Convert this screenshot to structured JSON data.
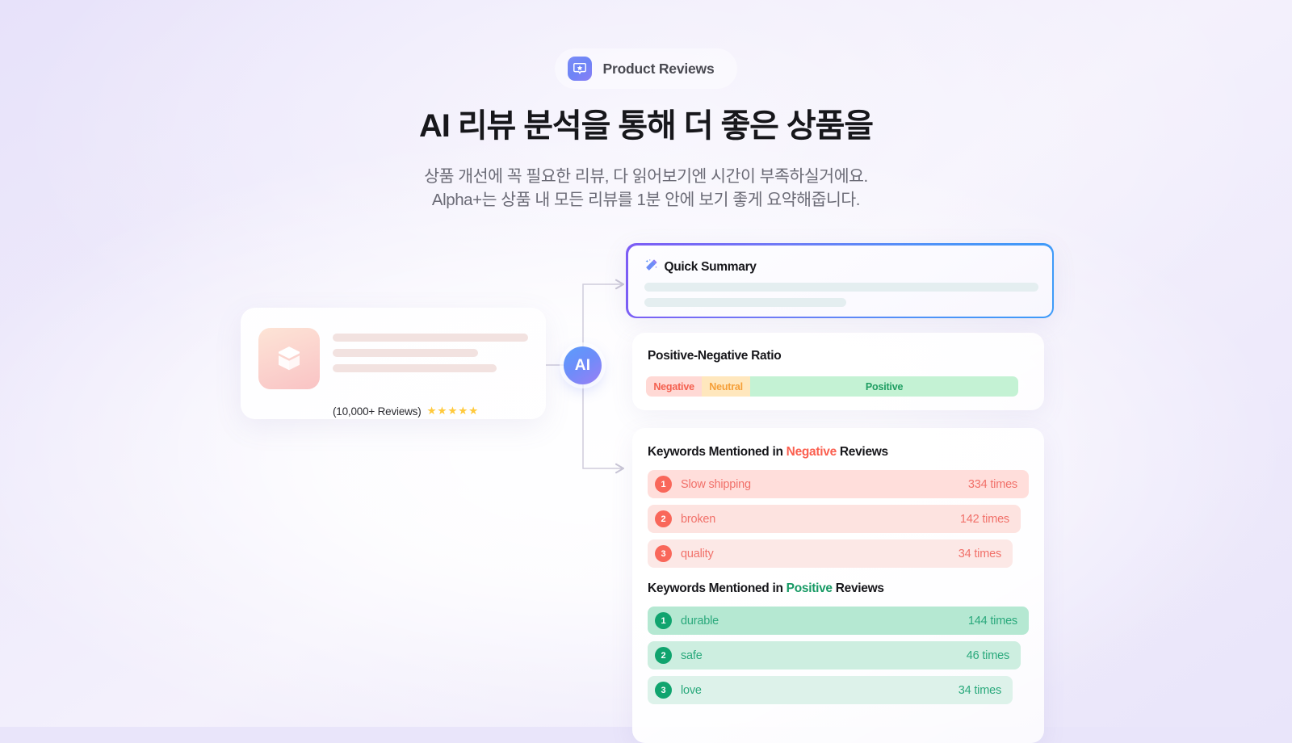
{
  "header": {
    "badge_label": "Product Reviews",
    "badge_icon": "star-bubble-icon",
    "headline": "AI 리뷰 분석을 통해 더 좋은 상품을",
    "subtitle_line1": "상품 개선에 꼭 필요한 리뷰, 다 읽어보기엔 시간이 부족하실거에요.",
    "subtitle_line2": "Alpha+는 상품 내 모든 리뷰를 1분 안에 보기 좋게 요약해줍니다."
  },
  "product_card": {
    "thumb_icon": "package-box-icon",
    "reviews_label": "(10,000+ Reviews)",
    "stars": "★★★★★",
    "star_count": 5
  },
  "ai_node": {
    "label": "AI"
  },
  "quick_summary": {
    "icon": "magic-wand-icon",
    "title": "Quick Summary"
  },
  "ratio": {
    "title": "Positive-Negative Ratio",
    "segments": [
      {
        "label": "Negative",
        "percent": 15,
        "bg": "#ffd9d5",
        "color": "#f4604f"
      },
      {
        "label": "Neutral",
        "percent": 13,
        "bg": "#ffe7bd",
        "color": "#f59f38"
      },
      {
        "label": "Positive",
        "percent": 72,
        "bg": "#c4f2d4",
        "color": "#1f9e62"
      }
    ]
  },
  "keywords": {
    "negative": {
      "heading_prefix": "Keywords Mentioned in ",
      "heading_accent": "Negative",
      "heading_suffix": " Reviews",
      "accent_color": "#fb5f4f",
      "items": [
        {
          "rank": "1",
          "word": "Slow shipping",
          "count": "334 times"
        },
        {
          "rank": "2",
          "word": "broken",
          "count": "142 times"
        },
        {
          "rank": "3",
          "word": "quality",
          "count": "34 times"
        }
      ]
    },
    "positive": {
      "heading_prefix": "Keywords Mentioned in ",
      "heading_accent": "Positive",
      "heading_suffix": " Reviews",
      "accent_color": "#189a65",
      "items": [
        {
          "rank": "1",
          "word": "durable",
          "count": "144 times"
        },
        {
          "rank": "2",
          "word": "safe",
          "count": "46 times"
        },
        {
          "rank": "3",
          "word": "love",
          "count": "34 times"
        }
      ]
    }
  }
}
